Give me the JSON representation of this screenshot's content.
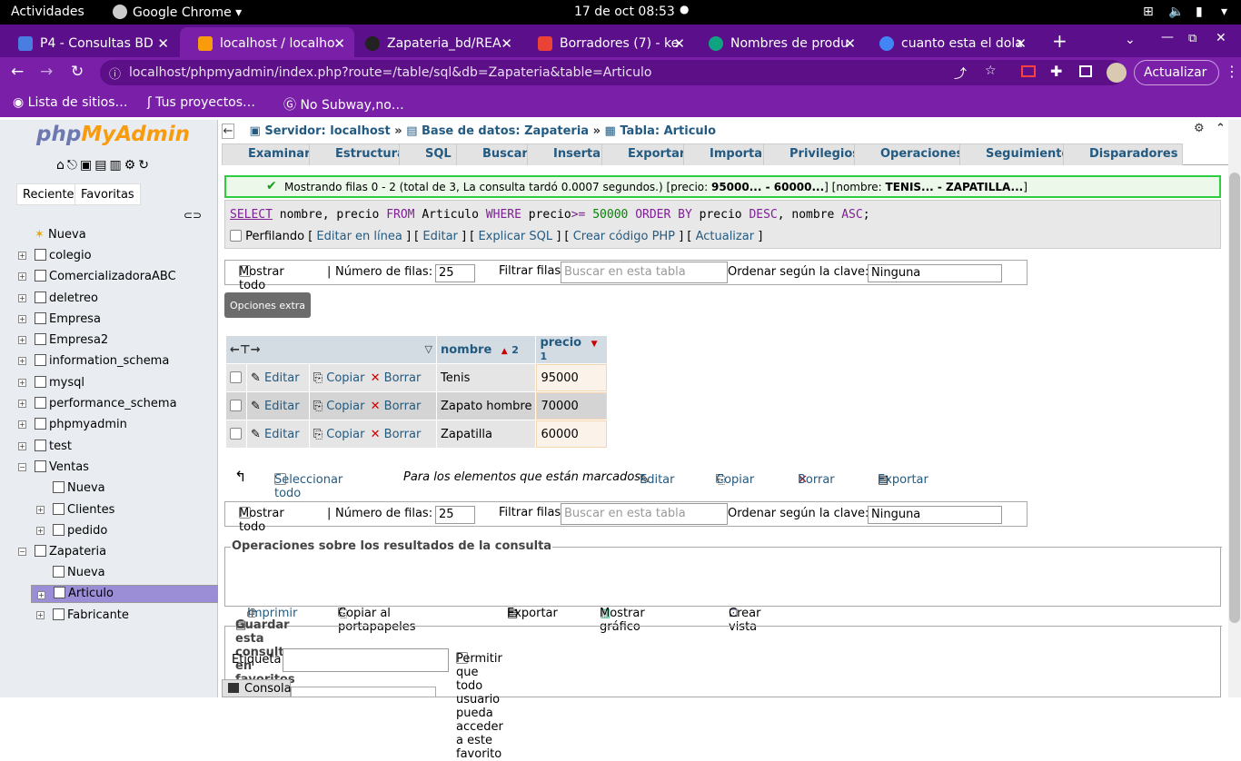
{
  "os": {
    "activities": "Actividades",
    "app": "Google Chrome",
    "datetime": "17 de oct  08:53"
  },
  "tabs": [
    {
      "label": "P4 - Consultas BD ",
      "color": "#4a7de0"
    },
    {
      "label": "localhost / localho",
      "color": "#f89c0e"
    },
    {
      "label": "Zapateria_bd/REA",
      "color": "#222222"
    },
    {
      "label": "Borradores (7) - ke",
      "color": "#ea4335"
    },
    {
      "label": "Nombres de produ",
      "color": "#10a37f"
    },
    {
      "label": "cuanto esta el dola",
      "color": "#4285f4"
    }
  ],
  "address": {
    "url": "localhost/phpmyadmin/index.php?route=/table/sql&db=Zapateria&table=Articulo",
    "update_label": "Actualizar"
  },
  "bookmarks": [
    "Lista de sitios…",
    "Tus proyectos…",
    "No Subway,no…"
  ],
  "sidebar": {
    "logo_php": "php",
    "logo_my": "MyAdmin",
    "tab_recent": "Reciente",
    "tab_fav": "Favoritas",
    "items": [
      {
        "label": "Nueva"
      },
      {
        "label": "colegio"
      },
      {
        "label": "ComercializadoraABC"
      },
      {
        "label": "deletreo"
      },
      {
        "label": "Empresa"
      },
      {
        "label": "Empresa2"
      },
      {
        "label": "information_schema"
      },
      {
        "label": "mysql"
      },
      {
        "label": "performance_schema"
      },
      {
        "label": "phpmyadmin"
      },
      {
        "label": "test"
      },
      {
        "label": "Ventas"
      },
      {
        "label": "Nueva"
      },
      {
        "label": "Clientes"
      },
      {
        "label": "pedido"
      },
      {
        "label": "Zapateria"
      },
      {
        "label": "Nueva"
      },
      {
        "label": "Articulo"
      },
      {
        "label": "Fabricante"
      }
    ]
  },
  "breadcrumb": {
    "server": "Servidor: localhost",
    "db": "Base de datos: Zapateria",
    "table": "Tabla: Articulo"
  },
  "main_tabs": [
    "Examinar",
    "Estructura",
    "SQL",
    "Buscar",
    "Insertar",
    "Exportar",
    "Importar",
    "Privilegios",
    "Operaciones",
    "Seguimiento",
    "Disparadores"
  ],
  "message": {
    "text": "Mostrando filas 0 - 2 (total de 3, La consulta tardó 0.0007 segundos.) [precio: ",
    "b1": "95000... - 60000...",
    "mid": "] [nombre: ",
    "b2": "TENIS... - ZAPATILLA...",
    "end": "]"
  },
  "sql": {
    "select": "SELECT",
    "cols": " nombre, precio ",
    "from": "FROM",
    "table": " Articulo ",
    "where": "WHERE",
    "col": " precio",
    "op": ">=",
    "val": " 50000 ",
    "order": "ORDER BY",
    "o1": " precio ",
    "desc": "DESC",
    "o2": ", nombre ",
    "asc": "ASC",
    "semi": ";"
  },
  "profiling": {
    "label": "Perfilando",
    "l1": "Editar en línea",
    "l2": "Editar",
    "l3": "Explicar SQL",
    "l4": "Crear código PHP",
    "l5": "Actualizar"
  },
  "nav": {
    "show_all": "Mostrar todo",
    "rows_label": "Número de filas:",
    "rows_value": "25",
    "filter_label": "Filtrar filas:",
    "filter_placeholder": "Buscar en esta tabla",
    "sort_label": "Ordenar según la clave:",
    "sort_value": "Ninguna"
  },
  "extra_options": "Opciones extra",
  "columns": [
    {
      "name": "nombre",
      "order": "2"
    },
    {
      "name": "precio",
      "order": "1"
    }
  ],
  "rows": [
    {
      "nombre": "Tenis",
      "precio": "95000"
    },
    {
      "nombre": "Zapato hombre",
      "precio": "70000"
    },
    {
      "nombre": "Zapatilla",
      "precio": "60000"
    }
  ],
  "row_actions": {
    "edit": "Editar",
    "copy": "Copiar",
    "delete": "Borrar"
  },
  "bulk": {
    "select_all": "Seleccionar todo",
    "marked": "Para los elementos que están marcados:",
    "edit": "Editar",
    "copy": "Copiar",
    "delete": "Borrar",
    "export": "Exportar"
  },
  "ops": {
    "legend": "Operaciones sobre los resultados de la consulta",
    "print": "Imprimir",
    "clipboard": "Copiar al portapapeles",
    "export": "Exportar",
    "chart": "Mostrar gráfico",
    "view": "Crear vista"
  },
  "fav": {
    "legend": "Guardar esta consulta en favoritos",
    "label": "Etiqueta:",
    "public": "Permitir que todo usuario pueda acceder a este favorito"
  },
  "console": "Consola"
}
